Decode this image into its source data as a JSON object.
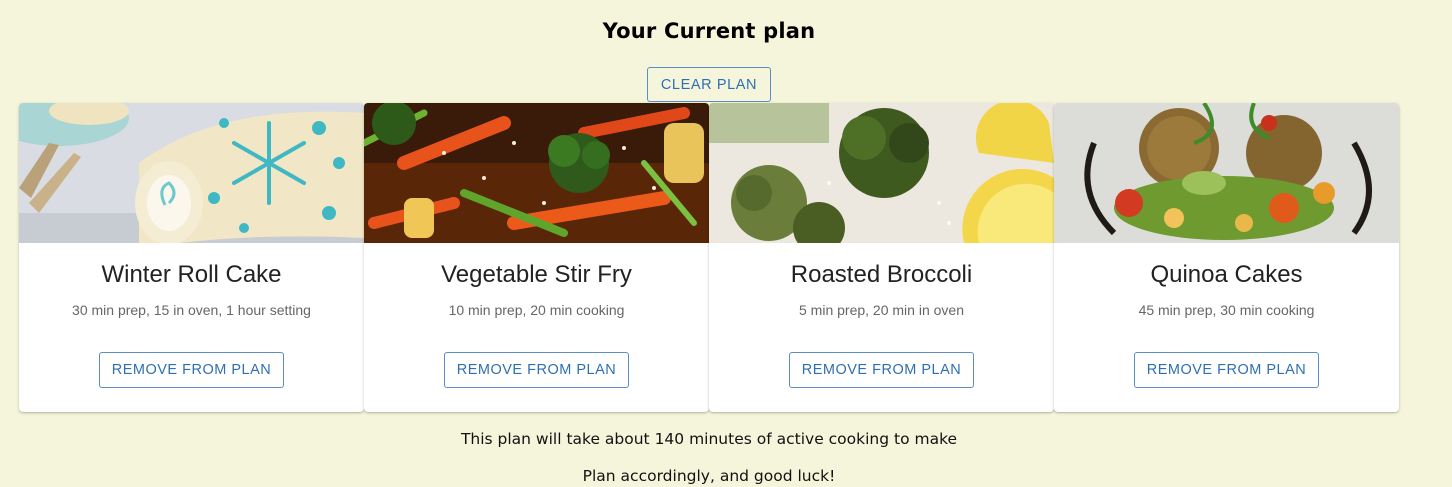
{
  "header": {
    "title": "Your Current plan"
  },
  "actions": {
    "clear_label": "CLEAR PLAN"
  },
  "cards": [
    {
      "title": "Winter Roll Cake",
      "subtitle": "30 min prep, 15 in oven, 1 hour setting",
      "button_label": "REMOVE FROM PLAN",
      "image": "rolled-cake-with-snowflake-pattern"
    },
    {
      "title": "Vegetable Stir Fry",
      "subtitle": "10 min prep, 20 min cooking",
      "button_label": "REMOVE FROM PLAN",
      "image": "stir-fried-vegetables-with-sesame"
    },
    {
      "title": "Roasted Broccoli",
      "subtitle": "5 min prep, 20 min in oven",
      "button_label": "REMOVE FROM PLAN",
      "image": "roasted-broccoli-with-lemon"
    },
    {
      "title": "Quinoa Cakes",
      "subtitle": "45 min prep, 30 min cooking",
      "button_label": "REMOVE FROM PLAN",
      "image": "quinoa-cakes-with-vegetables"
    }
  ],
  "footer": {
    "summary": "This plan will take about 140 minutes of active cooking to make",
    "closing": "Plan accordingly, and good luck!"
  },
  "colors": {
    "background": "#f5f5dc",
    "accent": "#2f6fb3",
    "card": "#ffffff"
  }
}
